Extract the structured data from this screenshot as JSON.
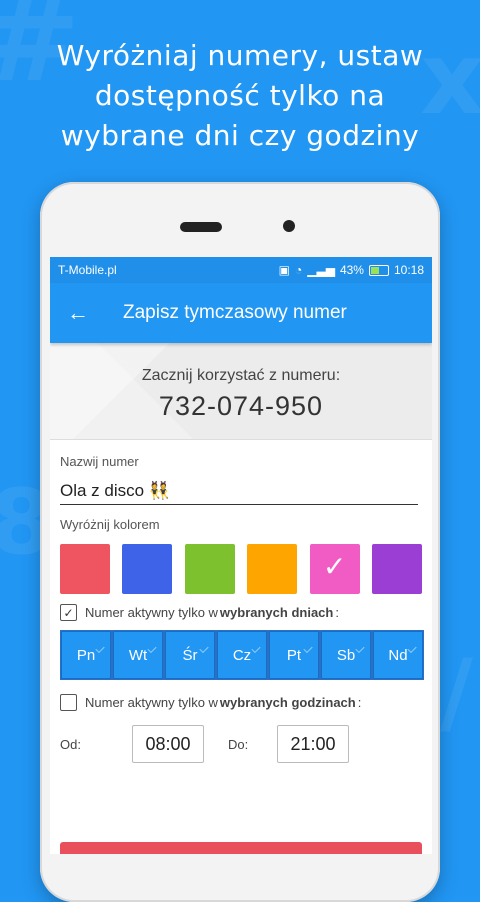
{
  "headline": {
    "line1": "Wyróżniaj numery, ustaw",
    "line2": "dostępność tylko na",
    "line3": "wybrane dni czy godziny"
  },
  "status_bar": {
    "carrier": "T-Mobile.pl",
    "battery": "43%",
    "time": "10:18"
  },
  "app_bar": {
    "back_icon": "arrow-left-icon",
    "title": "Zapisz tymczasowy numer"
  },
  "header": {
    "label": "Zacznij korzystać z numeru:",
    "number": "732-074-950"
  },
  "form": {
    "name_label": "Nazwij numer",
    "name_value": "Ola z disco 👯",
    "color_label": "Wyróżnij kolorem",
    "colors": [
      {
        "hex": "#EF5461",
        "selected": false
      },
      {
        "hex": "#3F63E8",
        "selected": false
      },
      {
        "hex": "#7DC12F",
        "selected": false
      },
      {
        "hex": "#FFA500",
        "selected": false
      },
      {
        "hex": "#F15CC4",
        "selected": true
      },
      {
        "hex": "#9B3FD4",
        "selected": false
      }
    ],
    "days_check": {
      "checked": true,
      "text_before": "Numer aktywny tylko w",
      "text_bold": "wybranych dniach",
      "text_after": ":"
    },
    "days": [
      "Pn",
      "Wt",
      "Śr",
      "Cz",
      "Pt",
      "Sb",
      "Nd"
    ],
    "hours_check": {
      "checked": false,
      "text_before": "Numer aktywny tylko w",
      "text_bold": "wybranych godzinach",
      "text_after": ":"
    },
    "from_label": "Od:",
    "from_value": "08:00",
    "to_label": "Do:",
    "to_value": "21:00"
  }
}
